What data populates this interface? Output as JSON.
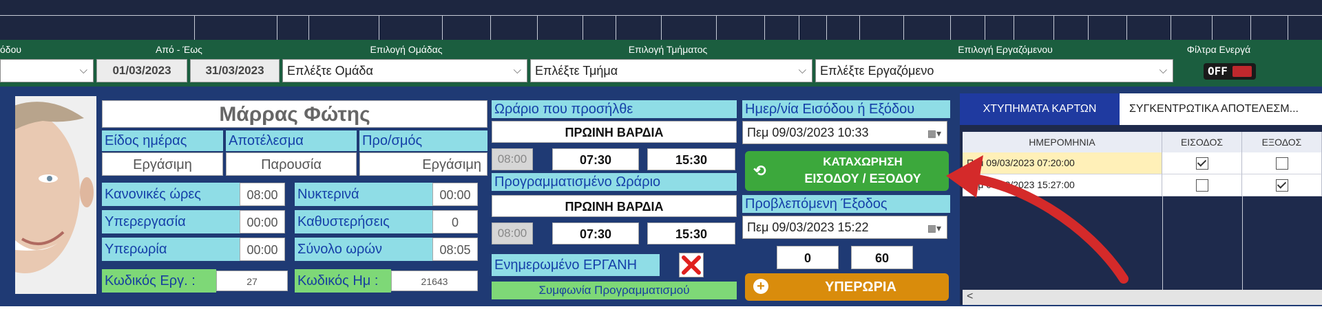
{
  "filters": {
    "period_label_partial": "όδου",
    "date_range_label": "Από - Έως",
    "date_from": "01/03/2023",
    "date_to": "31/03/2023",
    "group_label": "Επιλογή Ομάδας",
    "group_value": "Επλέξτε Ομάδα",
    "department_label": "Επιλογή Τμήματος",
    "department_value": "Επλέξτε Τμήμα",
    "employee_label": "Επιλογή Εργαζόμενου",
    "employee_value": "Επλέξτε Εργαζόμενο",
    "active_filters_label": "Φίλτρα Ενεργά",
    "toggle_state": "OFF"
  },
  "employee": {
    "name": "Μάρρας Φώτης",
    "day_type_label": "Είδος ημέρας",
    "result_label": "Αποτέλεσμα",
    "scheduled_label": "Προ/σμός",
    "day_type_value": "Εργάσιμη",
    "result_value": "Παρουσία",
    "scheduled_value": "Εργάσιμη",
    "regular_hours_label": "Κανονικές ώρες",
    "regular_hours_value": "08:00",
    "night_label": "Νυκτερινά",
    "night_value": "00:00",
    "overtime_work_label": "Υπερεργασία",
    "overtime_work_value": "00:00",
    "delays_label": "Καθυστερήσεις",
    "delays_value": "0",
    "overtime_label": "Υπερωρία",
    "overtime_value": "00:00",
    "total_hours_label": "Σύνολο ωρών",
    "total_hours_value": "08:05",
    "emp_code_label": "Κωδικός Εργ. :",
    "emp_code_value": "27",
    "day_code_label": "Κωδικός Ημ :",
    "day_code_value": "21643"
  },
  "schedule": {
    "arrived_label": "Ωράριο που προσήλθε",
    "arrived_shift": "ΠΡΩΙΝΗ ΒΑΡΔΙΑ",
    "arrived_hours": "08:00",
    "arrived_start": "07:30",
    "arrived_end": "15:30",
    "planned_label": "Προγραμματισμένο Ωράριο",
    "planned_shift": "ΠΡΩΙΝΗ ΒΑΡΔΙΑ",
    "planned_hours": "08:00",
    "planned_start": "07:30",
    "planned_end": "15:30",
    "erganh_label": "Ενημερωμένο ΕΡΓΑΝΗ",
    "agreement_label": "Συμφωνία Προγραμματισμού"
  },
  "entry": {
    "datetime_label": "Ημερ/νία Εισόδου ή Εξόδου",
    "datetime_value": "Πεμ 09/03/2023 10:33",
    "register_button_line1": "ΚΑΤΑΧΩΡΗΣΗ",
    "register_button_line2": "ΕΙΣΟΔΟΥ / ΕΞΟΔΟΥ",
    "expected_exit_label": "Προβλεπόμενη Έξοδος",
    "expected_exit_value": "Πεμ 09/03/2023 15:22",
    "field_a": "0",
    "field_b": "60",
    "overtime_button": "ΥΠΕΡΩΡΙΑ"
  },
  "table": {
    "tabs": [
      "ΧΤΥΠΗΜΑΤΑ ΚΑΡΤΩΝ",
      "ΣΥΓΚΕΝΤΡΩΤΙΚΑ ΑΠΟΤΕΛΕΣΜ..."
    ],
    "headers": [
      "ΗΜΕΡΟΜΗΝΙΑ",
      "ΕΙΣΟΔΟΣ",
      "ΕΞΟΔΟΣ"
    ],
    "rows": [
      {
        "date": "Πεμ 09/03/2023 07:20:00",
        "entry": true,
        "exit": false
      },
      {
        "date": "Πεμ 09/03/2023 15:27:00",
        "entry": false,
        "exit": true
      }
    ],
    "scroll_left": "<"
  },
  "colors": {
    "accent_arrow": "#d42a2a",
    "header_green": "#1b5e3f",
    "panel_blue": "#1f3a74",
    "label_cyan": "#8fdde6",
    "button_green": "#3ca83c",
    "button_orange": "#d98c0c"
  }
}
